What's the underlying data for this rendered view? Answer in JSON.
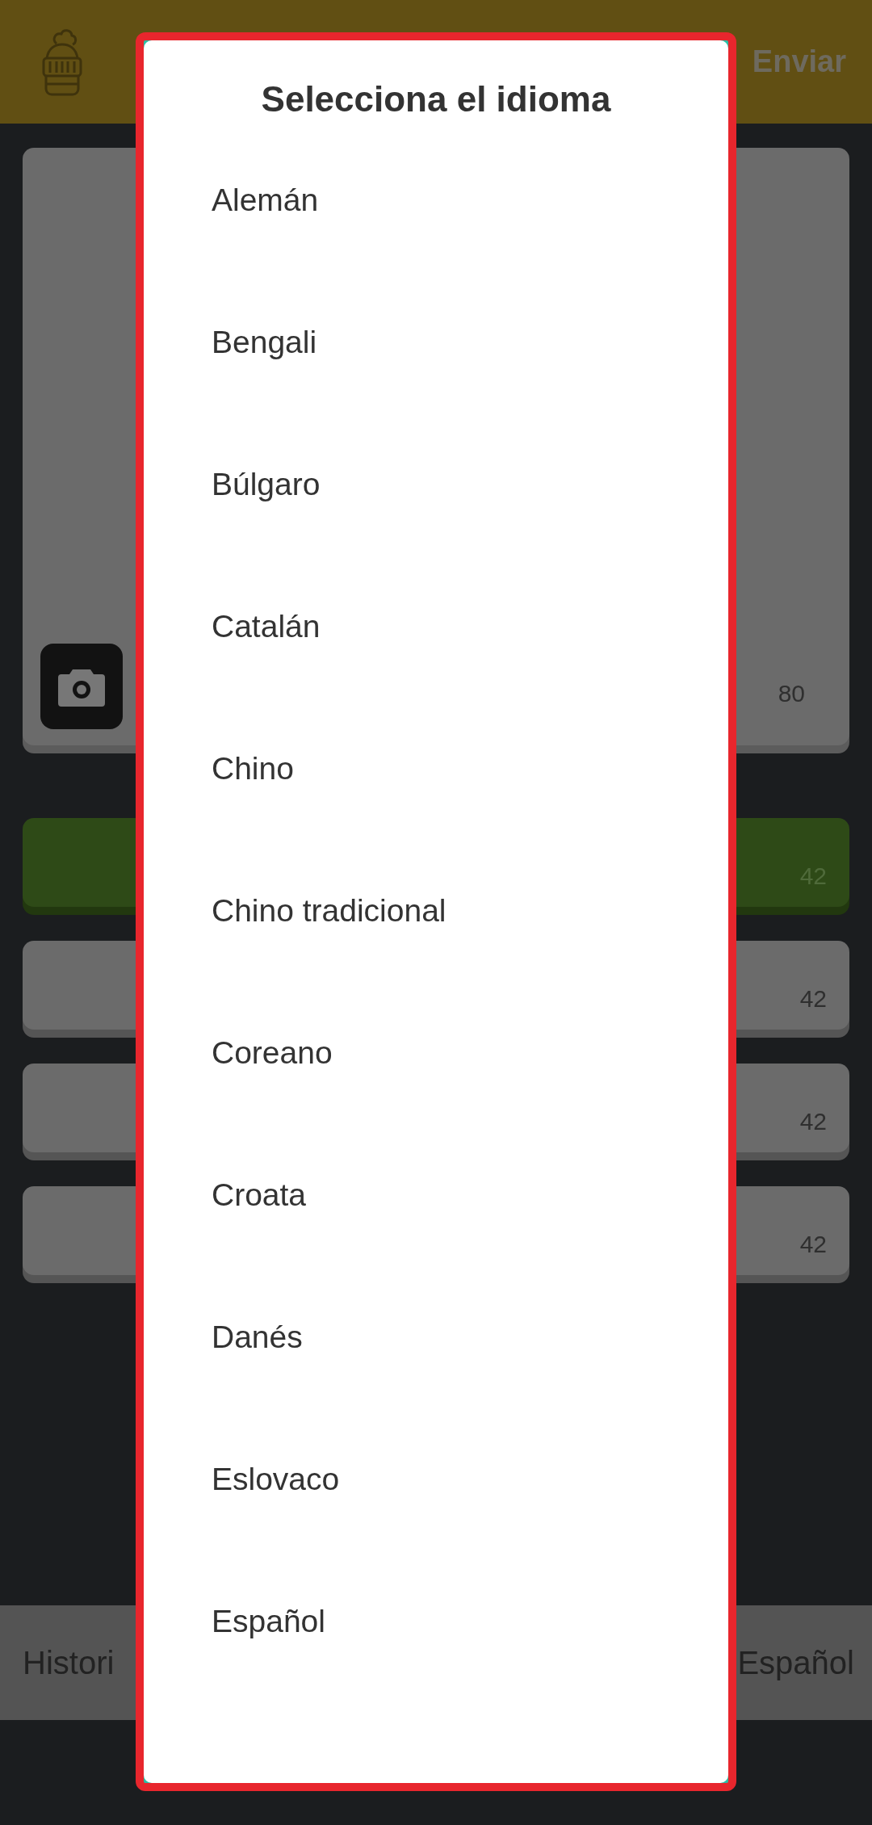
{
  "header": {
    "action": "Enviar"
  },
  "card": {
    "count": "80"
  },
  "rows": [
    {
      "count": "42",
      "selected": true
    },
    {
      "count": "42",
      "selected": false
    },
    {
      "count": "42",
      "selected": false
    },
    {
      "count": "42",
      "selected": false
    }
  ],
  "bottom_bar": {
    "left": "Histori",
    "right": "Español"
  },
  "dialog": {
    "title": "Selecciona el idioma",
    "items": [
      "Alemán",
      "Bengali",
      "Búlgaro",
      "Catalán",
      "Chino",
      "Chino tradicional",
      "Coreano",
      "Croata",
      "Danés",
      "Eslovaco",
      "Español"
    ]
  }
}
